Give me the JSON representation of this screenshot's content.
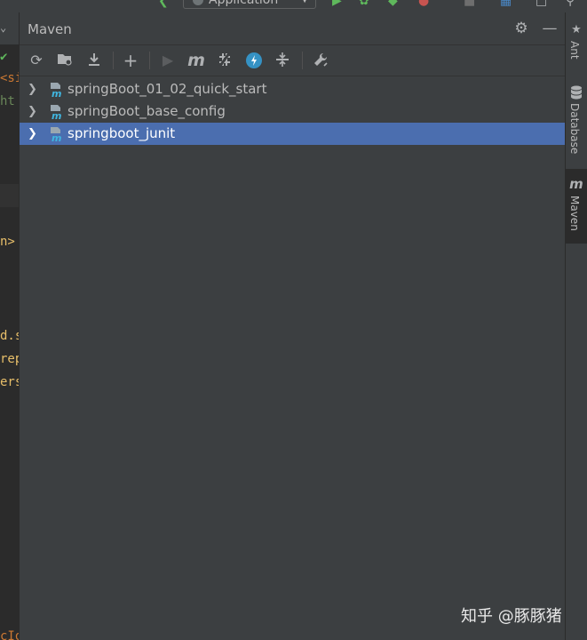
{
  "toolbar_top": {
    "run_config_label": "Application"
  },
  "editor_fragments": [
    {
      "text": "<s​i",
      "color": "#cc7832"
    },
    {
      "text": "ht",
      "color": "#6a8759"
    },
    {
      "text": "n>",
      "color": "#e8bf6a"
    },
    {
      "text": "d.s",
      "color": "#e8bf6a"
    },
    {
      "text": "rep",
      "color": "#e8bf6a"
    },
    {
      "text": "ers",
      "color": "#e8bf6a"
    },
    {
      "text": "cIo",
      "color": "#cc7832"
    }
  ],
  "maven": {
    "title": "Maven",
    "header_icons": [
      "gear-icon",
      "minimize-icon"
    ],
    "toolbar_icons": [
      "reload-icon",
      "generate-sources-icon",
      "download-icon",
      "add-icon",
      "run-icon",
      "execute-goal-icon",
      "toggle-offline-icon",
      "skip-tests-icon",
      "show-dependencies-icon",
      "build-tools-settings-icon"
    ],
    "projects": [
      {
        "label": "springBoot_01_02_quick_start",
        "selected": false
      },
      {
        "label": "springBoot_base_config",
        "selected": false
      },
      {
        "label": "springboot_junit",
        "selected": true
      }
    ]
  },
  "right_stripe": [
    {
      "label": "Ant",
      "icon": "ant-icon",
      "active": false
    },
    {
      "label": "Database",
      "icon": "database-icon",
      "active": false
    },
    {
      "label": "Maven",
      "icon": "maven-icon",
      "active": true
    }
  ],
  "watermark": "知乎 @豚豚猪",
  "colors": {
    "panel_bg": "#3c3f41",
    "editor_bg": "#2b2b2b",
    "selection": "#4b6eaf",
    "text": "#bbbbbb"
  }
}
